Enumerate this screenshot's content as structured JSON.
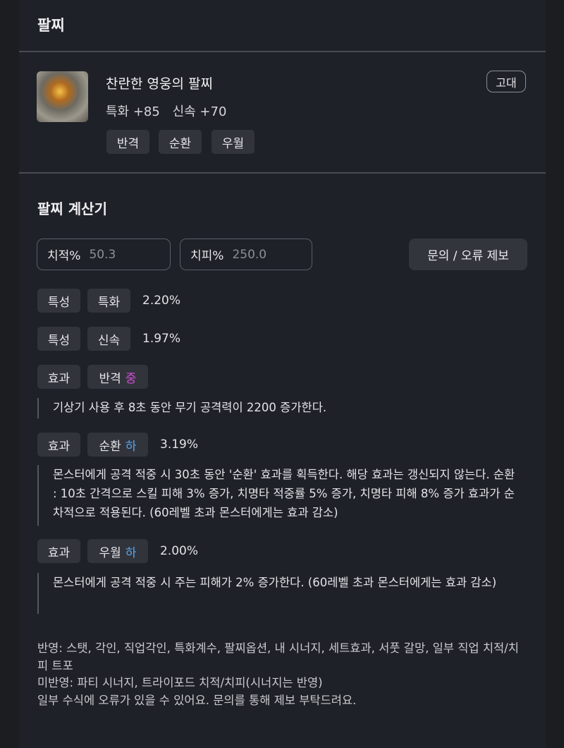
{
  "section_title": "팔찌",
  "item": {
    "name": "찬란한 영웅의 팔찌",
    "grade": "고대",
    "stats": [
      "특화 +85",
      "신속 +70"
    ],
    "tags": [
      "반격",
      "순환",
      "우월"
    ]
  },
  "calculator": {
    "title": "팔찌 계산기",
    "crit_label": "치적%",
    "crit_value": "50.3",
    "critdmg_label": "치피%",
    "critdmg_value": "250.0",
    "report_button": "문의 / 오류 제보",
    "rows": [
      {
        "type": "특성",
        "name": "특화",
        "value": "2.20%"
      },
      {
        "type": "특성",
        "name": "신속",
        "value": "1.97%"
      },
      {
        "type": "효과",
        "name": "반격",
        "level": "중",
        "description": "기상기 사용 후 8초 동안 무기 공격력이 2200 증가한다."
      },
      {
        "type": "효과",
        "name": "순환",
        "level": "하",
        "value": "3.19%",
        "description": "몬스터에게 공격 적중 시 30초 동안 '순환' 효과를 획득한다. 해당 효과는 갱신되지 않는다. 순환 : 10초 간격으로 스킬 피해 3% 증가, 치명타 적중률 5% 증가, 치명타 피해 8% 증가 효과가 순차적으로 적용된다. (60레벨 초과 몬스터에게는 효과 감소)"
      },
      {
        "type": "효과",
        "name": "우월",
        "level": "하",
        "value": "2.00%",
        "description": "몬스터에게 공격 적중 시 주는 피해가 2% 증가한다. (60레벨 초과 몬스터에게는 효과 감소)"
      }
    ]
  },
  "footer": [
    "반영: 스탯, 각인, 직업각인, 특화계수, 팔찌옵션, 내 시너지, 세트효과, 서풋 갈망, 일부 직업 치적/치피 트포",
    "미반영: 파티 시너지, 트라이포드 치적/치피(시너지는 반영)",
    "일부 수식에 오류가 있을 수 있어요. 문의를 통해 제보 부탁드려요."
  ],
  "colors": {
    "level_mid": "#d24fd8",
    "level_low": "#56a8f0"
  }
}
